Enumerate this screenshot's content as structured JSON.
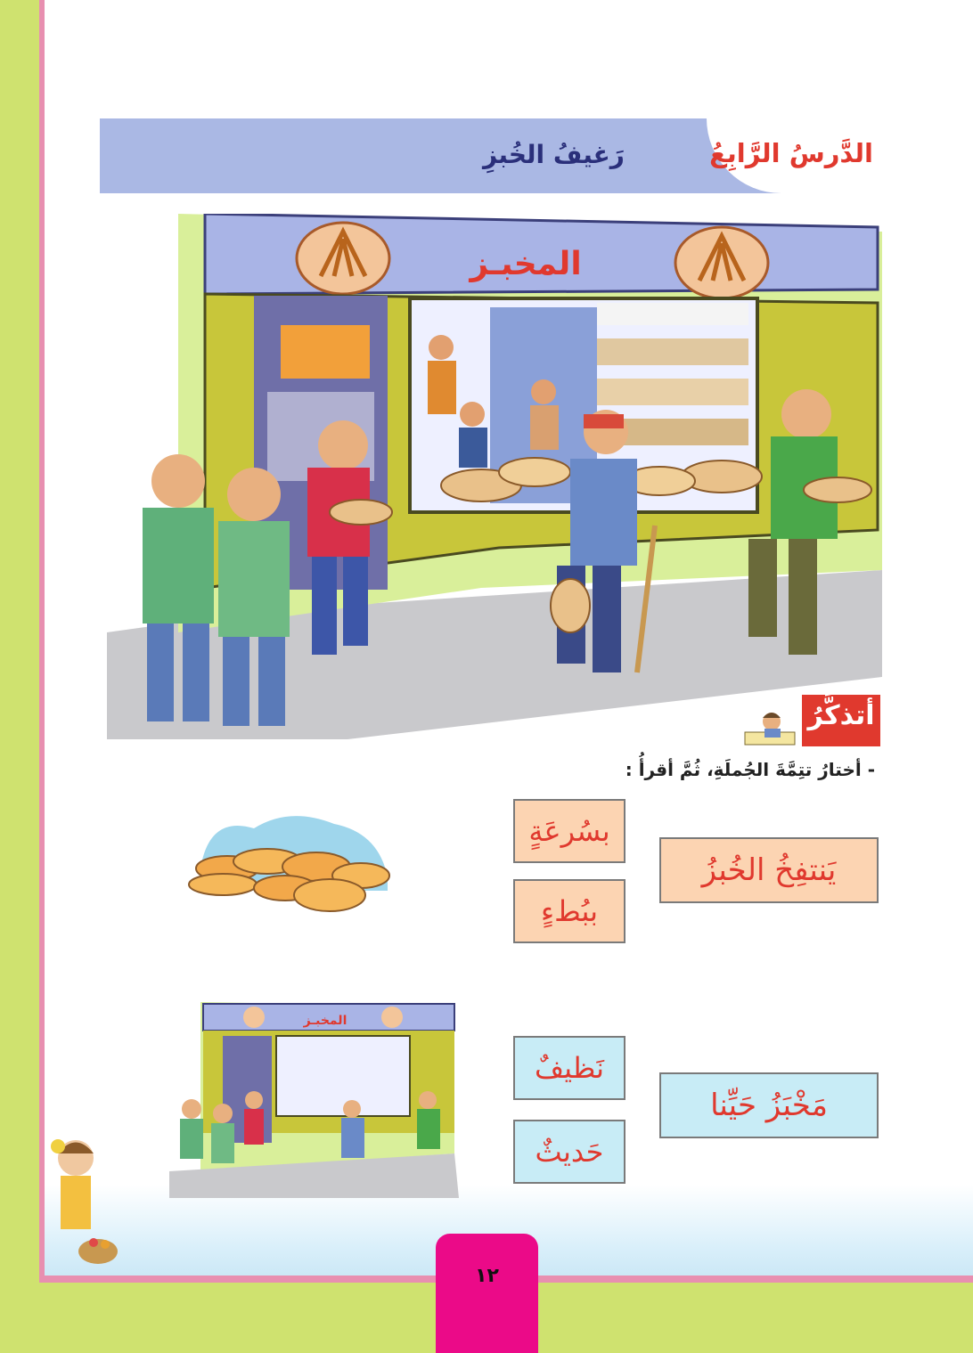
{
  "header": {
    "lesson_number": "الدَّرسُ الرَّابِعُ",
    "lesson_title": "رَغيفُ الخُبزِ"
  },
  "main_illustration": {
    "shop_sign": "المخبـز"
  },
  "remember": {
    "label": "أتذكَّرُ",
    "instruction": "-  أختارُ تتِمَّةَ الجُملَةِ، ثُمَّ أقرأُ :"
  },
  "exercises": [
    {
      "sentence": "يَنتفِخُ الخُبزُ",
      "options": [
        "بسُرعَةٍ",
        "ببُطءٍ"
      ]
    },
    {
      "sentence": "مَخْبَزُ حَيِّنا",
      "options": [
        "نَظيفٌ",
        "حَديثٌ"
      ]
    }
  ],
  "mini_illustration": {
    "shop_sign": "المخبـز"
  },
  "footer": {
    "page_number": "١٢"
  },
  "colors": {
    "header_bg": "#aab8e4",
    "title_red": "#e0392e",
    "title_navy": "#2a2f7a",
    "frame_green": "#cfe26f",
    "frame_pink": "#e88fb0",
    "peach_box": "#fcd4b2",
    "blue_box": "#c8ecf6",
    "page_tab": "#eb0a88"
  }
}
